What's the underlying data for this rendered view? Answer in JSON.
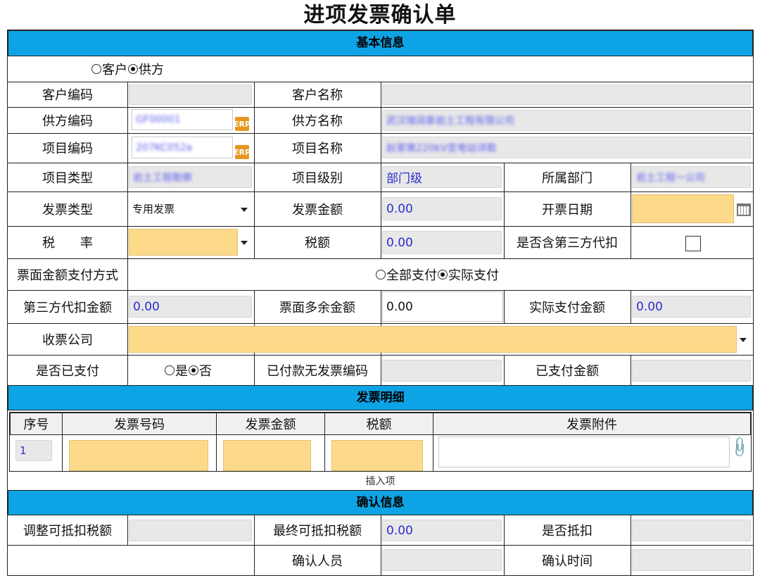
{
  "page_title": "进项发票确认单",
  "sections": {
    "basic": "基本信息",
    "details": "发票明细",
    "confirm": "确认信息"
  },
  "party_type": {
    "customer": "客户",
    "supplier": "供方",
    "selected": "供方"
  },
  "labels": {
    "customer_code": "客户编码",
    "customer_name": "客户名称",
    "supplier_code": "供方编码",
    "supplier_name": "供方名称",
    "project_code": "项目编码",
    "project_name": "项目名称",
    "project_type": "项目类型",
    "project_level": "项目级别",
    "department": "所属部门",
    "invoice_type": "发票类型",
    "invoice_amount": "发票金额",
    "invoice_date": "开票日期",
    "tax_rate": "税　　率",
    "tax_amount": "税额",
    "third_party_withhold": "是否含第三方代扣",
    "payment_method": "票面金额支付方式",
    "third_party_amount": "第三方代扣金额",
    "surplus_amount": "票面多余金额",
    "actual_payment": "实际支付金额",
    "receiving_company": "收票公司",
    "is_paid": "是否已支付",
    "paid_no_invoice_code": "已付款无发票编码",
    "paid_amount": "已支付金额",
    "adjust_deductible_tax": "调整可抵扣税额",
    "final_deductible_tax": "最终可抵扣税额",
    "is_deducted": "是否抵扣",
    "confirmer": "确认人员",
    "confirm_time": "确认时间"
  },
  "values": {
    "supplier_code": "GF00001",
    "supplier_name": "武汉瑞润泰岩土工程有限公司",
    "project_code": "207KC052a",
    "project_name": "赵家墩220kV变电站详勘",
    "project_type": "岩土工程勘察",
    "project_level": "部门级",
    "department": "岩土工程一公司",
    "invoice_type": "专用发票",
    "invoice_amount": "0.00",
    "tax_amount": "0.00",
    "third_party_amount": "0.00",
    "surplus_amount": "0.00",
    "actual_payment": "0.00",
    "final_deductible_tax": "0.00",
    "erp_icon_text": "ERP"
  },
  "payment_options": {
    "full": "全部支付",
    "actual": "实际支付",
    "selected": "实际支付"
  },
  "paid_options": {
    "yes": "是",
    "no": "否",
    "selected": "否"
  },
  "detail_table": {
    "columns": [
      "序号",
      "发票号码",
      "发票金额",
      "税额",
      "发票附件"
    ],
    "rows": [
      {
        "index": "1"
      }
    ],
    "insert_label": "插入项"
  },
  "colors": {
    "section_bar": "#0ea3e4",
    "required_field": "#fdd98a",
    "readonly_field": "#e8e8e8",
    "value_text": "#2c2ccf"
  },
  "icons": {
    "erp": "erp-icon",
    "calendar": "calendar-icon",
    "dropdown": "chevron-down-icon",
    "attachment": "paperclip-icon"
  }
}
